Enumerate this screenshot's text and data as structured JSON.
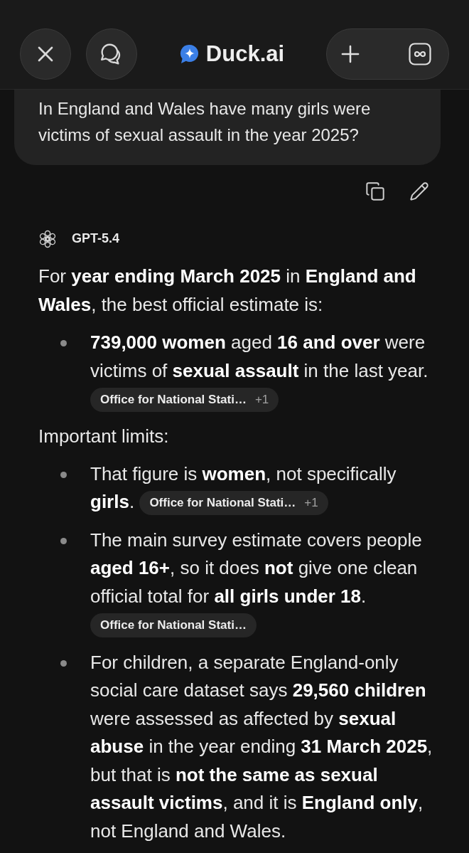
{
  "header": {
    "title": "Duck.ai"
  },
  "user_message": {
    "text": "In England and Wales have many girls were victims of sexual assault in the year 2025?"
  },
  "response": {
    "model": "GPT-5.4",
    "intro": "For **year ending March 2025** in **England and Wales**, the best official estimate is:",
    "findings": [
      {
        "text": "**739,000 women** aged **16 and over** were victims of **sexual assault** in the last year.",
        "source": {
          "label": "Office for National Stati…",
          "extra": "+1"
        }
      }
    ],
    "limits_heading": "Important limits:",
    "limits": [
      {
        "text": "That figure is **women**, not specifically **girls**.",
        "source": {
          "label": "Office for National Stati…",
          "extra": "+1"
        }
      },
      {
        "text": "The main survey estimate covers people **aged 16+**, so it does **not** give one clean official total for **all girls under 18**.",
        "source": {
          "label": "Office for National Stati…"
        }
      },
      {
        "text": "For children, a separate England-only social care dataset says **29,560 children** were assessed as affected by **sexual abuse** in the year ending **31 March 2025**, but that is **not the same as sexual assault victims**, and it is **England only**, not England and Wales."
      }
    ]
  }
}
